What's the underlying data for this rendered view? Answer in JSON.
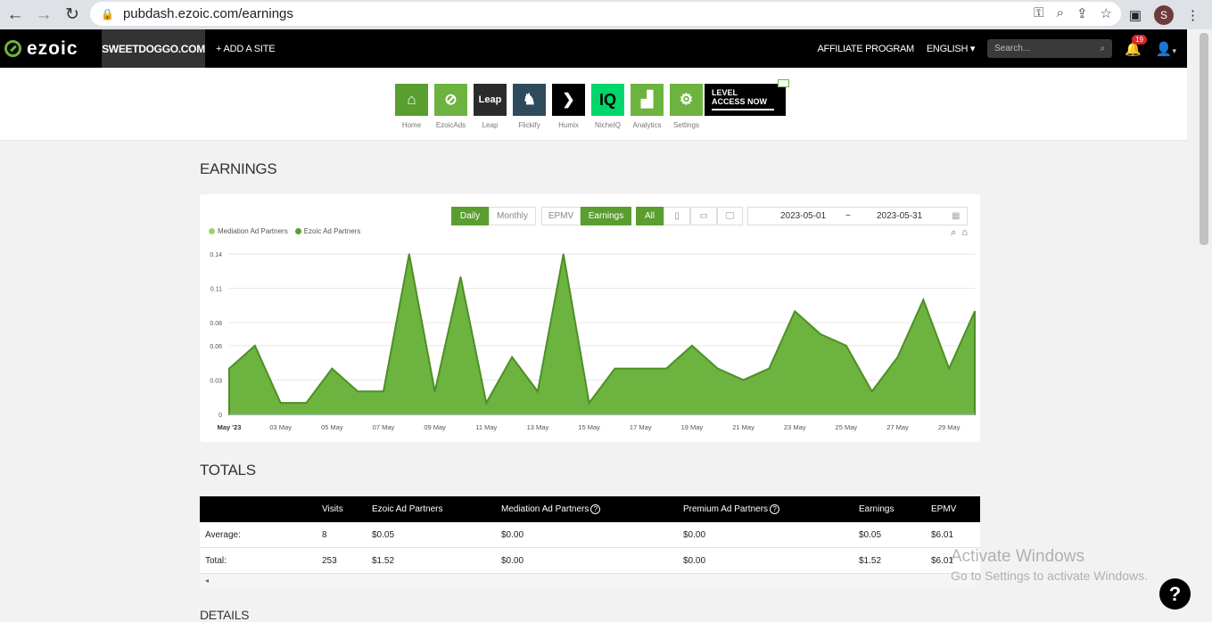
{
  "browser": {
    "url": "pubdash.ezoic.com/earnings",
    "profile_initial": "S"
  },
  "topnav": {
    "logo": "ezoic",
    "site": "SWEETDOGGO.COM",
    "add_site": "+ ADD A SITE",
    "affiliate": "AFFILIATE PROGRAM",
    "language": "ENGLISH",
    "search_placeholder": "Search...",
    "notifications": "19"
  },
  "apps": [
    {
      "label": "Home",
      "color": "#5a9e2f"
    },
    {
      "label": "EzoicAds",
      "color": "#6cb33f"
    },
    {
      "label": "Leap",
      "color": "#2b2b2b",
      "text": "Leap"
    },
    {
      "label": "Flickify",
      "color": "#2d4b5a"
    },
    {
      "label": "Humix",
      "color": "#000000"
    },
    {
      "label": "NicheIQ",
      "color": "#00d66b",
      "text": "IQ"
    },
    {
      "label": "Analytics",
      "color": "#6cb33f"
    },
    {
      "label": "Settings",
      "color": "#6cb33f"
    }
  ],
  "level_banner": [
    "LEVEL",
    "ACCESS NOW"
  ],
  "earnings": {
    "title": "EARNINGS",
    "buttons": {
      "daily": "Daily",
      "monthly": "Monthly",
      "epmv": "EPMV",
      "earnings": "Earnings",
      "all": "All"
    },
    "date_start": "2023-05-01",
    "date_sep": "~",
    "date_end": "2023-05-31",
    "legend": [
      {
        "name": "Mediation Ad Partners",
        "color": "#9bd16f"
      },
      {
        "name": "Ezoic Ad Partners",
        "color": "#5a9e2f"
      }
    ]
  },
  "chart_data": {
    "type": "area",
    "x_labels": [
      "May '23",
      "03 May",
      "05 May",
      "07 May",
      "09 May",
      "11 May",
      "13 May",
      "15 May",
      "17 May",
      "19 May",
      "21 May",
      "23 May",
      "25 May",
      "27 May",
      "29 May"
    ],
    "x": [
      "01 May",
      "02 May",
      "03 May",
      "04 May",
      "05 May",
      "06 May",
      "07 May",
      "08 May",
      "09 May",
      "10 May",
      "11 May",
      "12 May",
      "13 May",
      "14 May",
      "15 May",
      "16 May",
      "17 May",
      "18 May",
      "19 May",
      "20 May",
      "21 May",
      "22 May",
      "23 May",
      "24 May",
      "25 May",
      "26 May",
      "27 May",
      "28 May",
      "29 May",
      "30 May"
    ],
    "series": [
      {
        "name": "Ezoic Ad Partners",
        "color": "#6cb33f",
        "values": [
          0.04,
          0.06,
          0.01,
          0.01,
          0.04,
          0.02,
          0.02,
          0.14,
          0.02,
          0.12,
          0.01,
          0.05,
          0.02,
          0.14,
          0.01,
          0.04,
          0.04,
          0.04,
          0.06,
          0.04,
          0.03,
          0.04,
          0.09,
          0.07,
          0.06,
          0.02,
          0.05,
          0.1,
          0.04,
          0.09
        ]
      }
    ],
    "y_ticks": [
      "0",
      "0.03",
      "0.06",
      "0.08",
      "0.11",
      "0.14"
    ],
    "ylim": [
      0,
      0.14
    ]
  },
  "totals": {
    "title": "TOTALS",
    "columns": [
      "Visits",
      "Ezoic Ad Partners",
      "Mediation Ad Partners",
      "Premium Ad Partners",
      "Earnings",
      "EPMV"
    ],
    "rows": [
      {
        "label": "Average:",
        "cells": [
          "8",
          "$0.05",
          "$0.00",
          "$0.00",
          "$0.05",
          "$6.01"
        ]
      },
      {
        "label": "Total:",
        "cells": [
          "253",
          "$1.52",
          "$0.00",
          "$0.00",
          "$1.52",
          "$6.01"
        ]
      }
    ]
  },
  "details_title": "DETAILS",
  "watermark": {
    "line1": "Activate Windows",
    "line2": "Go to Settings to activate Windows."
  },
  "help": "?"
}
